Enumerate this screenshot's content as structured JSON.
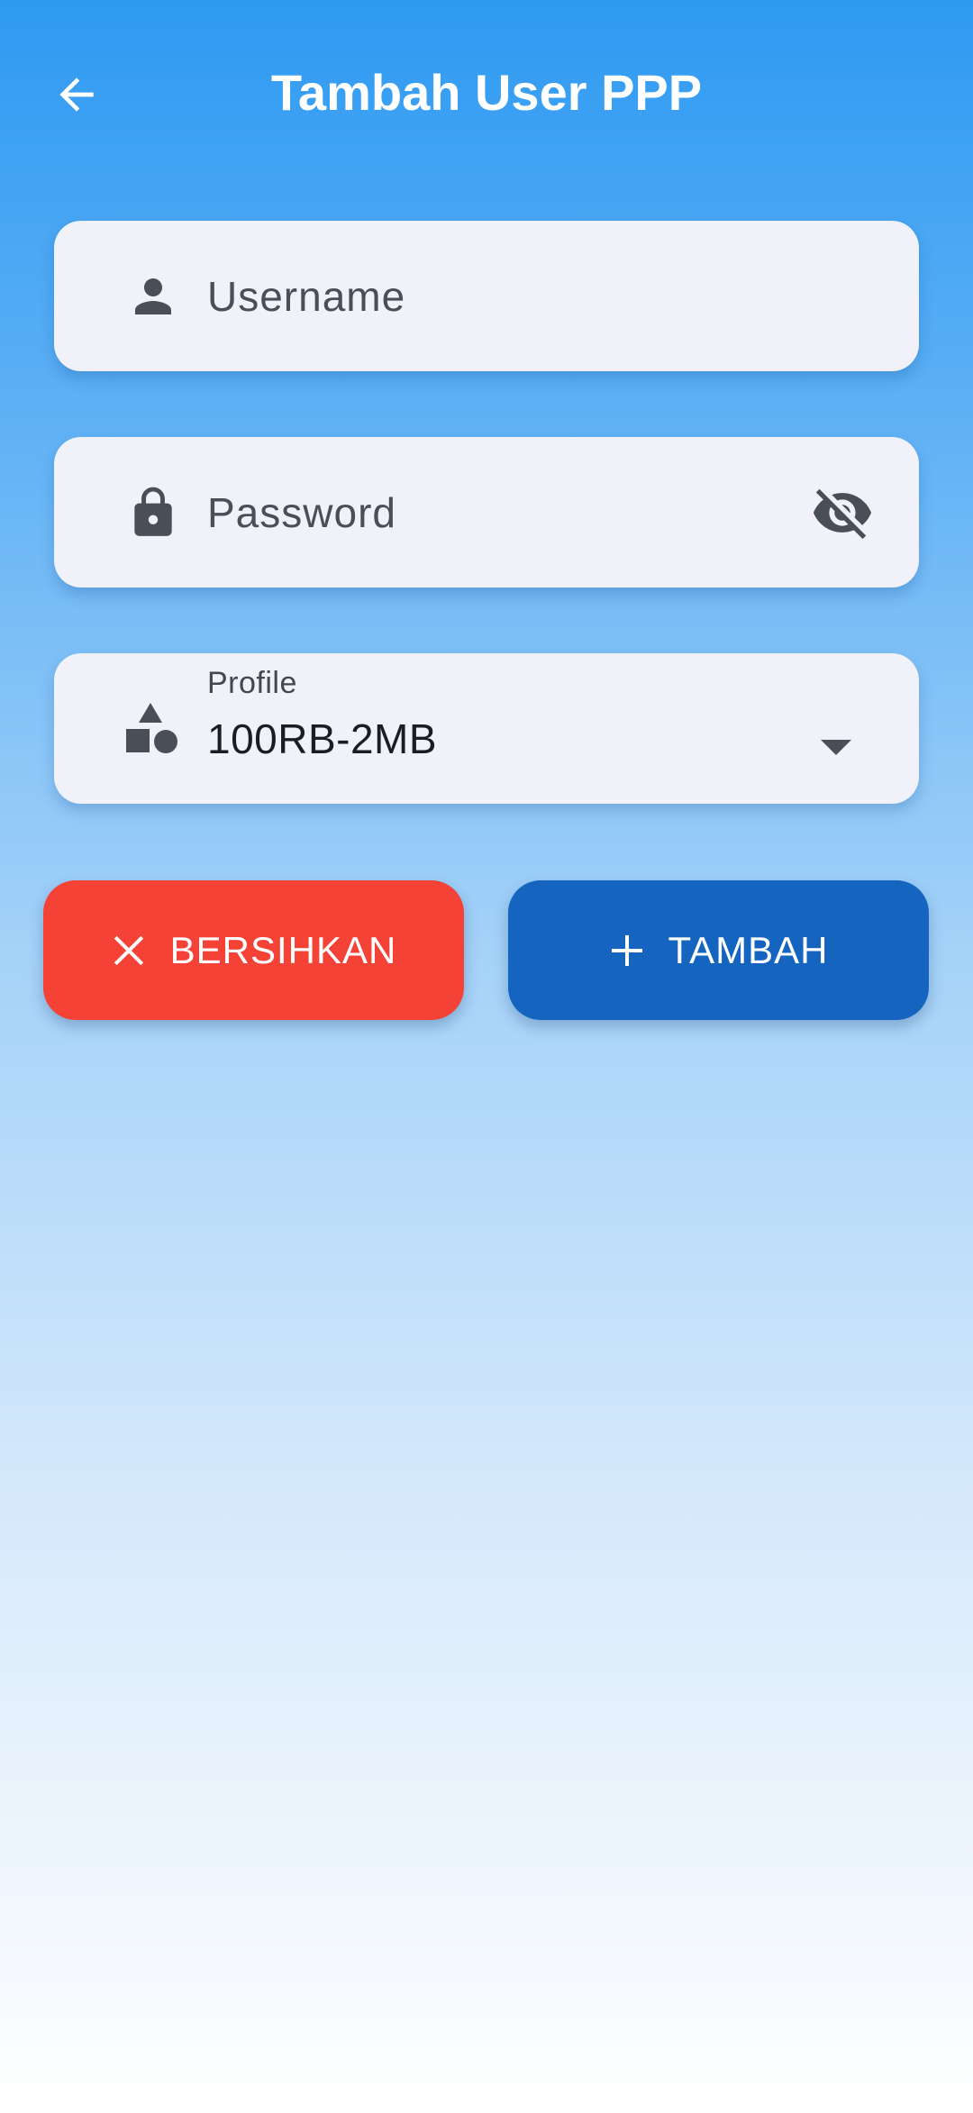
{
  "header": {
    "title": "Tambah User PPP",
    "back_icon": "arrow-left-icon"
  },
  "form": {
    "username": {
      "placeholder": "Username",
      "value": "",
      "icon": "person-icon"
    },
    "password": {
      "placeholder": "Password",
      "value": "",
      "icon": "lock-icon",
      "visibility_icon": "eye-off-icon"
    },
    "profile": {
      "label": "Profile",
      "selected": "100RB-2MB",
      "icon": "shapes-icon"
    }
  },
  "actions": {
    "clear_label": "BERSIHKAN",
    "add_label": "TAMBAH"
  },
  "colors": {
    "gradient_top": "#2e9af2",
    "gradient_bottom": "#ffffff",
    "field_background": "#f1f2f9",
    "clear_button": "#f44336",
    "add_button": "#1565c0",
    "icon": "#4a4e57"
  }
}
